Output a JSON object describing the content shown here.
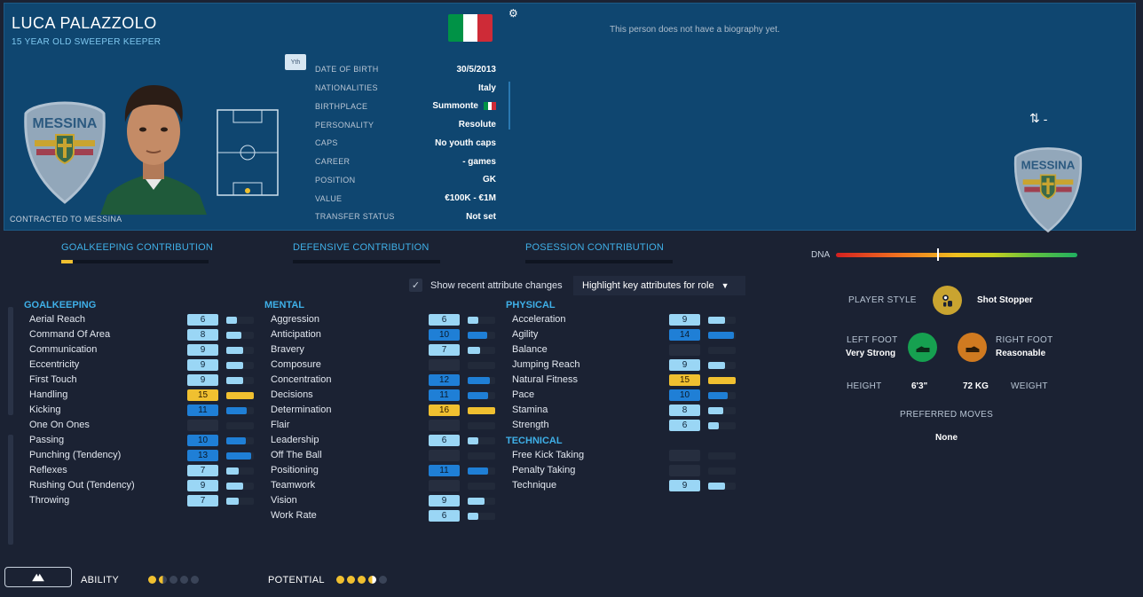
{
  "player": {
    "name": "LUCA PALAZZOLO",
    "role": "15 YEAR OLD SWEEPER KEEPER",
    "contracted": "CONTRACTED TO MESSINA",
    "youth_badge": "Yth",
    "club_crest_text": "MESSINA",
    "flag_colors": [
      "#009246",
      "#ffffff",
      "#ce2b37"
    ]
  },
  "info": [
    {
      "label": "DATE OF BIRTH",
      "value": "30/5/2013"
    },
    {
      "label": "NATIONALITIES",
      "value": "Italy"
    },
    {
      "label": "BIRTHPLACE",
      "value": "Summonte"
    },
    {
      "label": "PERSONALITY",
      "value": "Resolute"
    },
    {
      "label": "CAPS",
      "value": "No youth caps"
    },
    {
      "label": "CAREER",
      "value": "- games"
    },
    {
      "label": "POSITION",
      "value": "GK"
    },
    {
      "label": "VALUE",
      "value": "€100K - €1M"
    },
    {
      "label": "TRANSFER STATUS",
      "value": "Not set"
    }
  ],
  "biography": "This person does not have a biography yet.",
  "swap_value": "-",
  "contributions": [
    {
      "title": "GOALKEEPING CONTRIBUTION",
      "fill": 0.08
    },
    {
      "title": "DEFENSIVE CONTRIBUTION",
      "fill": 0
    },
    {
      "title": "POSESSION CONTRIBUTION",
      "fill": 0
    }
  ],
  "controls": {
    "checkbox_label": "Show recent attribute changes",
    "checkbox_checked": true,
    "dropdown_label": "Highlight key attributes for role"
  },
  "attributes": {
    "goalkeeping": {
      "title": "GOALKEEPING",
      "items": [
        {
          "name": "Aerial Reach",
          "value": "6",
          "style": "light",
          "bar": 0.4
        },
        {
          "name": "Command Of Area",
          "value": "8",
          "style": "light",
          "bar": 0.55
        },
        {
          "name": "Communication",
          "value": "9",
          "style": "light",
          "bar": 0.6
        },
        {
          "name": "Eccentricity",
          "value": "9",
          "style": "light",
          "bar": 0.6
        },
        {
          "name": "First Touch",
          "value": "9",
          "style": "light",
          "bar": 0.6
        },
        {
          "name": "Handling",
          "value": "15",
          "style": "gold",
          "bar": 1.0
        },
        {
          "name": "Kicking",
          "value": "11",
          "style": "mid",
          "bar": 0.75
        },
        {
          "name": "One On Ones",
          "value": "",
          "style": "empty",
          "bar": 0
        },
        {
          "name": "Passing",
          "value": "10",
          "style": "mid",
          "bar": 0.7
        },
        {
          "name": "Punching (Tendency)",
          "value": "13",
          "style": "mid",
          "bar": 0.9
        },
        {
          "name": "Reflexes",
          "value": "7",
          "style": "light",
          "bar": 0.45
        },
        {
          "name": "Rushing Out (Tendency)",
          "value": "9",
          "style": "light",
          "bar": 0.6
        },
        {
          "name": "Throwing",
          "value": "7",
          "style": "light",
          "bar": 0.45
        }
      ]
    },
    "mental": {
      "title": "MENTAL",
      "items": [
        {
          "name": "Aggression",
          "value": "6",
          "style": "light",
          "bar": 0.4
        },
        {
          "name": "Anticipation",
          "value": "10",
          "style": "mid",
          "bar": 0.7
        },
        {
          "name": "Bravery",
          "value": "7",
          "style": "light",
          "bar": 0.45
        },
        {
          "name": "Composure",
          "value": "",
          "style": "empty",
          "bar": 0
        },
        {
          "name": "Concentration",
          "value": "12",
          "style": "mid",
          "bar": 0.8
        },
        {
          "name": "Decisions",
          "value": "11",
          "style": "mid",
          "bar": 0.75
        },
        {
          "name": "Determination",
          "value": "16",
          "style": "gold",
          "bar": 1.0
        },
        {
          "name": "Flair",
          "value": "",
          "style": "empty",
          "bar": 0
        },
        {
          "name": "Leadership",
          "value": "6",
          "style": "light",
          "bar": 0.4
        },
        {
          "name": "Off The Ball",
          "value": "",
          "style": "empty",
          "bar": 0
        },
        {
          "name": "Positioning",
          "value": "11",
          "style": "mid",
          "bar": 0.75
        },
        {
          "name": "Teamwork",
          "value": "",
          "style": "empty",
          "bar": 0
        },
        {
          "name": "Vision",
          "value": "9",
          "style": "light",
          "bar": 0.6
        },
        {
          "name": "Work Rate",
          "value": "6",
          "style": "light",
          "bar": 0.4
        }
      ]
    },
    "physical": {
      "title": "PHYSICAL",
      "items": [
        {
          "name": "Acceleration",
          "value": "9",
          "style": "light",
          "bar": 0.6
        },
        {
          "name": "Agility",
          "value": "14",
          "style": "mid",
          "bar": 0.95
        },
        {
          "name": "Balance",
          "value": "",
          "style": "empty",
          "bar": 0
        },
        {
          "name": "Jumping Reach",
          "value": "9",
          "style": "light",
          "bar": 0.6
        },
        {
          "name": "Natural Fitness",
          "value": "15",
          "style": "gold",
          "bar": 1.0
        },
        {
          "name": "Pace",
          "value": "10",
          "style": "mid",
          "bar": 0.7
        },
        {
          "name": "Stamina",
          "value": "8",
          "style": "light",
          "bar": 0.55
        },
        {
          "name": "Strength",
          "value": "6",
          "style": "light",
          "bar": 0.4
        }
      ]
    },
    "technical": {
      "title": "TECHNICAL",
      "items": [
        {
          "name": "Free Kick Taking",
          "value": "",
          "style": "empty",
          "bar": 0
        },
        {
          "name": "Penalty Taking",
          "value": "",
          "style": "empty",
          "bar": 0
        },
        {
          "name": "Technique",
          "value": "9",
          "style": "light",
          "bar": 0.6
        }
      ]
    }
  },
  "dna": {
    "label": "DNA",
    "marker": 0.42
  },
  "profile": {
    "player_style_label": "PLAYER STYLE",
    "player_style_value": "Shot Stopper",
    "left_foot_label": "LEFT FOOT",
    "left_foot_value": "Very Strong",
    "right_foot_label": "RIGHT FOOT",
    "right_foot_value": "Reasonable",
    "height_label": "HEIGHT",
    "height_value": "6'3\"",
    "weight_value": "72 KG",
    "weight_label": "WEIGHT",
    "preferred_moves_label": "PREFERRED MOVES",
    "preferred_moves_value": "None"
  },
  "footer": {
    "ability_label": "ABILITY",
    "ability_stars": 1.5,
    "potential_label": "POTENTIAL",
    "potential_stars": 3.5
  },
  "colors": {
    "accent": "#3fb0e8",
    "header_bg": "#0f4670",
    "gold": "#f0c030",
    "mid_blue": "#1f7fd6",
    "light_blue": "#9ad6f5"
  }
}
